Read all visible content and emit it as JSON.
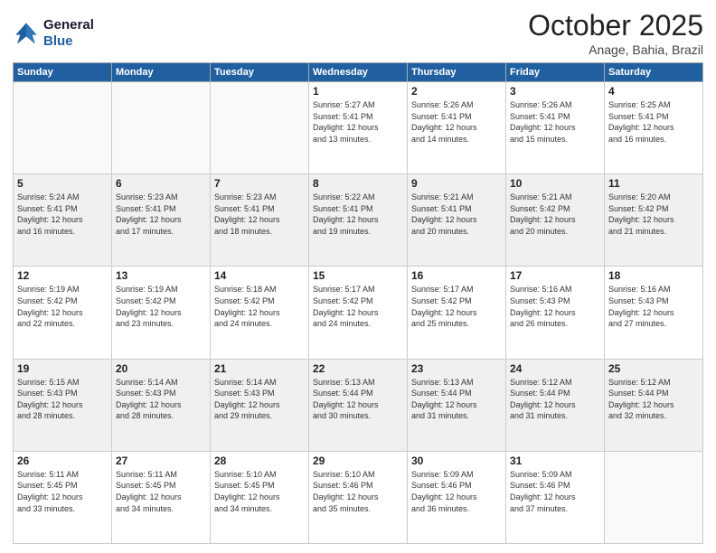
{
  "logo": {
    "line1": "General",
    "line2": "Blue"
  },
  "header": {
    "month": "October 2025",
    "location": "Anage, Bahia, Brazil"
  },
  "weekdays": [
    "Sunday",
    "Monday",
    "Tuesday",
    "Wednesday",
    "Thursday",
    "Friday",
    "Saturday"
  ],
  "weeks": [
    [
      {
        "day": "",
        "info": ""
      },
      {
        "day": "",
        "info": ""
      },
      {
        "day": "",
        "info": ""
      },
      {
        "day": "1",
        "info": "Sunrise: 5:27 AM\nSunset: 5:41 PM\nDaylight: 12 hours\nand 13 minutes."
      },
      {
        "day": "2",
        "info": "Sunrise: 5:26 AM\nSunset: 5:41 PM\nDaylight: 12 hours\nand 14 minutes."
      },
      {
        "day": "3",
        "info": "Sunrise: 5:26 AM\nSunset: 5:41 PM\nDaylight: 12 hours\nand 15 minutes."
      },
      {
        "day": "4",
        "info": "Sunrise: 5:25 AM\nSunset: 5:41 PM\nDaylight: 12 hours\nand 16 minutes."
      }
    ],
    [
      {
        "day": "5",
        "info": "Sunrise: 5:24 AM\nSunset: 5:41 PM\nDaylight: 12 hours\nand 16 minutes."
      },
      {
        "day": "6",
        "info": "Sunrise: 5:23 AM\nSunset: 5:41 PM\nDaylight: 12 hours\nand 17 minutes."
      },
      {
        "day": "7",
        "info": "Sunrise: 5:23 AM\nSunset: 5:41 PM\nDaylight: 12 hours\nand 18 minutes."
      },
      {
        "day": "8",
        "info": "Sunrise: 5:22 AM\nSunset: 5:41 PM\nDaylight: 12 hours\nand 19 minutes."
      },
      {
        "day": "9",
        "info": "Sunrise: 5:21 AM\nSunset: 5:41 PM\nDaylight: 12 hours\nand 20 minutes."
      },
      {
        "day": "10",
        "info": "Sunrise: 5:21 AM\nSunset: 5:42 PM\nDaylight: 12 hours\nand 20 minutes."
      },
      {
        "day": "11",
        "info": "Sunrise: 5:20 AM\nSunset: 5:42 PM\nDaylight: 12 hours\nand 21 minutes."
      }
    ],
    [
      {
        "day": "12",
        "info": "Sunrise: 5:19 AM\nSunset: 5:42 PM\nDaylight: 12 hours\nand 22 minutes."
      },
      {
        "day": "13",
        "info": "Sunrise: 5:19 AM\nSunset: 5:42 PM\nDaylight: 12 hours\nand 23 minutes."
      },
      {
        "day": "14",
        "info": "Sunrise: 5:18 AM\nSunset: 5:42 PM\nDaylight: 12 hours\nand 24 minutes."
      },
      {
        "day": "15",
        "info": "Sunrise: 5:17 AM\nSunset: 5:42 PM\nDaylight: 12 hours\nand 24 minutes."
      },
      {
        "day": "16",
        "info": "Sunrise: 5:17 AM\nSunset: 5:42 PM\nDaylight: 12 hours\nand 25 minutes."
      },
      {
        "day": "17",
        "info": "Sunrise: 5:16 AM\nSunset: 5:43 PM\nDaylight: 12 hours\nand 26 minutes."
      },
      {
        "day": "18",
        "info": "Sunrise: 5:16 AM\nSunset: 5:43 PM\nDaylight: 12 hours\nand 27 minutes."
      }
    ],
    [
      {
        "day": "19",
        "info": "Sunrise: 5:15 AM\nSunset: 5:43 PM\nDaylight: 12 hours\nand 28 minutes."
      },
      {
        "day": "20",
        "info": "Sunrise: 5:14 AM\nSunset: 5:43 PM\nDaylight: 12 hours\nand 28 minutes."
      },
      {
        "day": "21",
        "info": "Sunrise: 5:14 AM\nSunset: 5:43 PM\nDaylight: 12 hours\nand 29 minutes."
      },
      {
        "day": "22",
        "info": "Sunrise: 5:13 AM\nSunset: 5:44 PM\nDaylight: 12 hours\nand 30 minutes."
      },
      {
        "day": "23",
        "info": "Sunrise: 5:13 AM\nSunset: 5:44 PM\nDaylight: 12 hours\nand 31 minutes."
      },
      {
        "day": "24",
        "info": "Sunrise: 5:12 AM\nSunset: 5:44 PM\nDaylight: 12 hours\nand 31 minutes."
      },
      {
        "day": "25",
        "info": "Sunrise: 5:12 AM\nSunset: 5:44 PM\nDaylight: 12 hours\nand 32 minutes."
      }
    ],
    [
      {
        "day": "26",
        "info": "Sunrise: 5:11 AM\nSunset: 5:45 PM\nDaylight: 12 hours\nand 33 minutes."
      },
      {
        "day": "27",
        "info": "Sunrise: 5:11 AM\nSunset: 5:45 PM\nDaylight: 12 hours\nand 34 minutes."
      },
      {
        "day": "28",
        "info": "Sunrise: 5:10 AM\nSunset: 5:45 PM\nDaylight: 12 hours\nand 34 minutes."
      },
      {
        "day": "29",
        "info": "Sunrise: 5:10 AM\nSunset: 5:46 PM\nDaylight: 12 hours\nand 35 minutes."
      },
      {
        "day": "30",
        "info": "Sunrise: 5:09 AM\nSunset: 5:46 PM\nDaylight: 12 hours\nand 36 minutes."
      },
      {
        "day": "31",
        "info": "Sunrise: 5:09 AM\nSunset: 5:46 PM\nDaylight: 12 hours\nand 37 minutes."
      },
      {
        "day": "",
        "info": ""
      }
    ]
  ]
}
